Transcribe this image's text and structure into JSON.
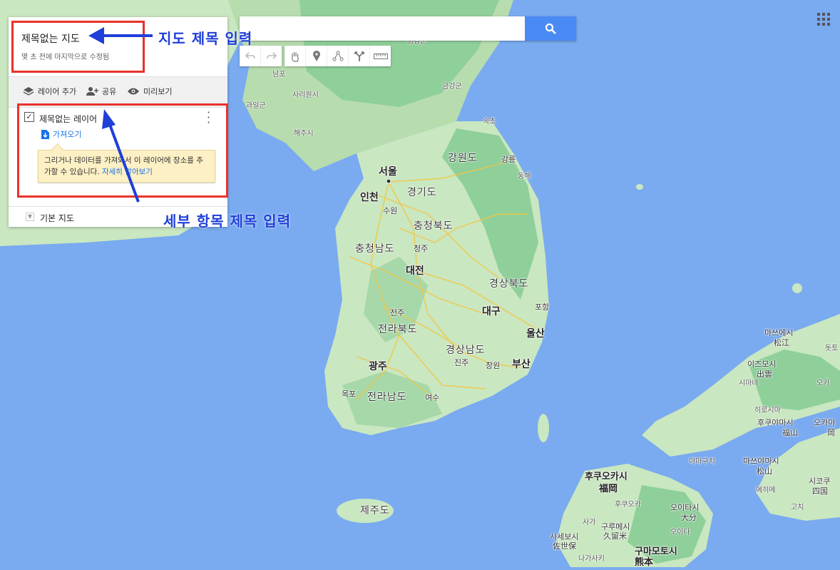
{
  "panel": {
    "title": "제목없는 지도",
    "subtitle": "몇 초 전에 마지막으로 수정됨",
    "toolbar": {
      "add_layer": "레이어 추가",
      "share": "공유",
      "preview": "미리보기"
    },
    "layer": {
      "name": "제목없는 레이어",
      "checked": true,
      "import_label": "가져오기"
    },
    "tooltip": {
      "text": "그리거나 데이터를 가져와서 이 레이어에 장소를 추가할 수 있습니다.",
      "link": "자세히 알아보기"
    },
    "basemap": "기본 지도"
  },
  "search": {
    "placeholder": ""
  },
  "annotations": {
    "map_title": "지도 제목 입력",
    "item_title": "세부  항목  제목 입력"
  },
  "map_labels": {
    "gangwon": "강원도",
    "gyeonggi": "경기도",
    "chungbuk": "충청북도",
    "chungnam": "충청남도",
    "gyeongbuk": "경상북도",
    "jeonbuk": "전라북도",
    "gyeongnam": "경상남도",
    "jeonnam": "전라남도",
    "jeju": "제주도",
    "seoul": "서울",
    "incheon": "인천",
    "suwon": "수원",
    "cheongju": "청주",
    "daejeon": "대전",
    "daegu": "대구",
    "pohang": "포항",
    "ulsan": "울산",
    "busan": "부산",
    "jeonju": "전주",
    "gwangju": "광주",
    "jinju": "진주",
    "changwon": "창원",
    "mokpo": "목포",
    "yeosu": "여수",
    "gangneung": "강릉",
    "donghae": "동해",
    "sokcho": "속초",
    "geumgang": "금강군",
    "sariwon": "사리원시",
    "gwail": "과일군",
    "nampo": "남포",
    "haeju": "해주시",
    "pyeonggang": "평강군",
    "fukuoka": "후쿠오카시",
    "fukuoka_kanji": "福岡",
    "fukuoka2": "후쿠오카",
    "matsue": "마쓰에시",
    "matsue_kanji": "松江",
    "izumo": "이즈모시",
    "izumo_kanji": "出雲",
    "shimane": "시마네",
    "hiroshima": "히로시마",
    "fukuyama": "후쿠야마시",
    "fukuyama_kanji": "福山",
    "yamaguchi": "야마구치",
    "matsuyama": "마쓰야마시",
    "matsuyama_kanji": "松山",
    "ehime": "에히메",
    "oita": "오이타시",
    "oita_kanji": "大分",
    "oita2": "오이타",
    "kurume": "구루메시",
    "kurume_kanji": "久留米",
    "sasebo": "사세보시",
    "sasebo_kanji": "佐世保",
    "kumamoto": "구마모토시",
    "kumamoto_kanji": "熊本",
    "saga": "사가",
    "nagasaki": "나가사키",
    "shikoku": "시코쿠",
    "shikoku_kanji": "四国",
    "kochi": "고치",
    "tottori": "돗토",
    "okayama": "오카야",
    "okayama_kanji": "岡",
    "kagawa": "오카"
  },
  "colors": {
    "sea": "#7aaaf0",
    "land": "#c9e7c0",
    "forest": "#8fcf9a",
    "road": "#f6c542",
    "annotation_red": "#e8322a",
    "annotation_blue": "#1f3fd8",
    "search_btn": "#4a8af4"
  }
}
